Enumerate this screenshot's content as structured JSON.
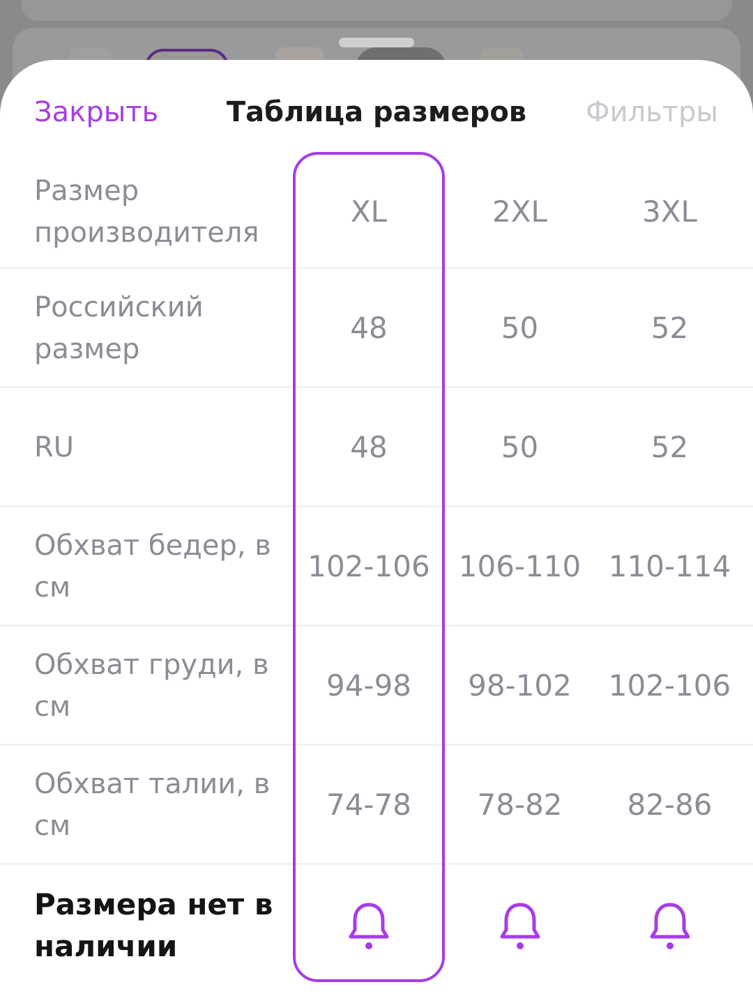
{
  "header": {
    "close_label": "Закрыть",
    "title": "Таблица размеров",
    "filters_label": "Фильтры"
  },
  "size_table": {
    "selected_size": "XL",
    "rows": [
      {
        "label": "Размер производителя",
        "values": [
          "XL",
          "2XL",
          "3XL"
        ]
      },
      {
        "label": "Российский размер",
        "values": [
          "48",
          "50",
          "52"
        ]
      },
      {
        "label": "RU",
        "values": [
          "48",
          "50",
          "52"
        ]
      },
      {
        "label": "Обхват бедер, в см",
        "values": [
          "102-106",
          "106-110",
          "110-114"
        ]
      },
      {
        "label": "Обхват груди, в см",
        "values": [
          "94-98",
          "98-102",
          "102-106"
        ]
      },
      {
        "label": "Обхват талии, в см",
        "values": [
          "74-78",
          "78-82",
          "82-86"
        ]
      }
    ],
    "availability": {
      "label": "Размера нет в наличии",
      "icons": [
        "bell-icon",
        "bell-icon",
        "bell-icon"
      ]
    }
  },
  "colors": {
    "accent": "#a63de6",
    "label_gray": "#8c8c96",
    "disabled": "#c9c9ce",
    "title": "#1c1c1e"
  }
}
